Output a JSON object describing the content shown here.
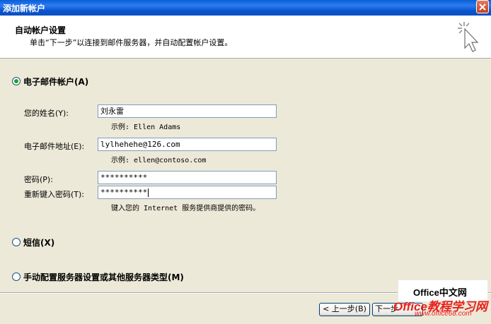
{
  "window": {
    "title": "添加新帐户"
  },
  "header": {
    "title": "自动帐户设置",
    "description": "单击“下一步”以连接到邮件服务器，并自动配置帐户设置。"
  },
  "options": {
    "email_account": {
      "label": "电子邮件帐户(A)",
      "selected": true
    },
    "sms": {
      "label": "短信(X)",
      "selected": false
    },
    "manual": {
      "label": "手动配置服务器设置或其他服务器类型(M)",
      "selected": false
    }
  },
  "form": {
    "name_label": "您的姓名(Y):",
    "name_value": "刘永雷",
    "name_hint": "示例: Ellen Adams",
    "email_label": "电子邮件地址(E):",
    "email_value": "lylhehehe@126.com",
    "email_hint": "示例: ellen@contoso.com",
    "password_label": "密码(P):",
    "password_value": "**********",
    "retype_label": "重新键入密码(T):",
    "retype_value": "**********",
    "password_hint": "键入您的 Internet 服务提供商提供的密码。"
  },
  "buttons": {
    "back": "< 上一步(B)",
    "next": "下一步"
  },
  "watermark": {
    "brand": "Office中文网",
    "tagline": "Office教程学习网",
    "url": "www.office68.com"
  }
}
